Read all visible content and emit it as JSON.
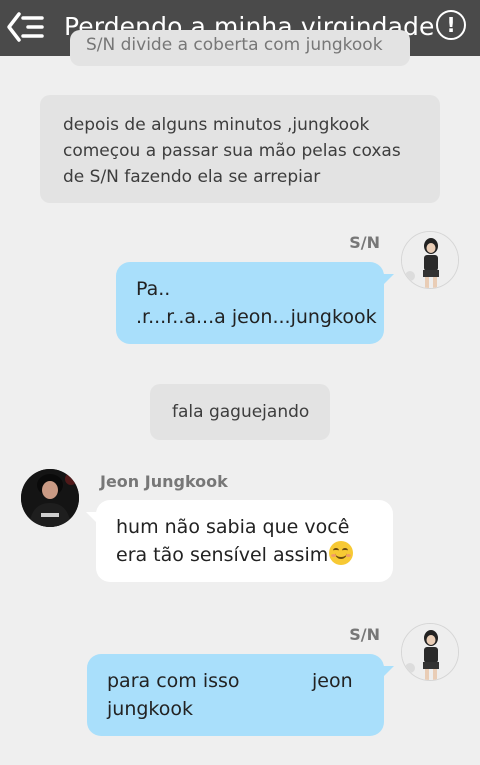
{
  "header": {
    "title": "Perdendo a minha virgindade",
    "back_icon": "back-menu-icon",
    "info_icon": "info-icon",
    "info_symbol": "!",
    "background": "#4a4a4a"
  },
  "messages": {
    "narration_top": "S/N divide a coberta com jungkook",
    "narration_1": "depois de alguns minutos ,jungkook começou a passar sua mão pelas coxas de S/N fazendo ela se arrepiar",
    "sn_name_1": "S/N",
    "bubble_1_line1": "Pa..",
    "bubble_1_line2": ".r...r..a...a jeon...jungkook",
    "narration_2": "fala gaguejando",
    "jk_name": "Jeon Jungkook",
    "bubble_2_line1": "hum não sabia que você",
    "bubble_2_line2": "era tão sensível assim",
    "bubble_2_emoji": "blushing-smile-emoji",
    "sn_name_2": "S/N",
    "bubble_3_line1": "para com isso            jeon",
    "bubble_3_line2": "jungkook"
  },
  "colors": {
    "outgoing_bubble": "#a9dffb",
    "incoming_bubble": "#ffffff",
    "narration_bubble": "#e3e3e3",
    "background": "#efefef"
  }
}
